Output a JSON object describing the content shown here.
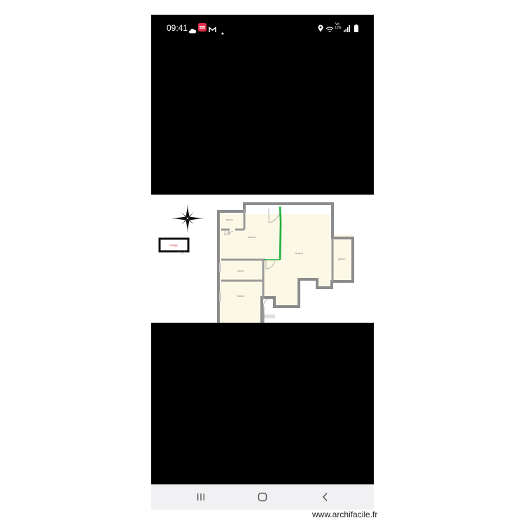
{
  "status_bar": {
    "time": "09:41",
    "network_label": "Vo\nLTE",
    "icons": [
      "cloud-icon",
      "app-badge-icon",
      "gmail-icon",
      "dot-icon",
      "location-icon",
      "wifi-icon",
      "signal-icon",
      "battery-icon"
    ]
  },
  "plan": {
    "compass": "compass-rose-icon",
    "annex_label": "Garage",
    "rooms": [
      {
        "id": "small",
        "label": "0.00 m²"
      },
      {
        "id": "main",
        "label": "24.35 m²"
      },
      {
        "id": "living",
        "label": "31.40 m²"
      },
      {
        "id": "closet",
        "label": "2.20 m²"
      },
      {
        "id": "bath",
        "label": "4.30 m²"
      },
      {
        "id": "bedroom",
        "label": "6.90 m²"
      }
    ]
  },
  "navbar": {
    "recent": "recent-apps-icon",
    "home": "home-icon",
    "back": "back-icon"
  },
  "watermark": "www.archifacile.fr",
  "colors": {
    "room_fill": "#fbf8e6",
    "wall": "#8a8a8a",
    "highlight_wall": "#1fae3c",
    "annex_red": "#cc2222"
  }
}
